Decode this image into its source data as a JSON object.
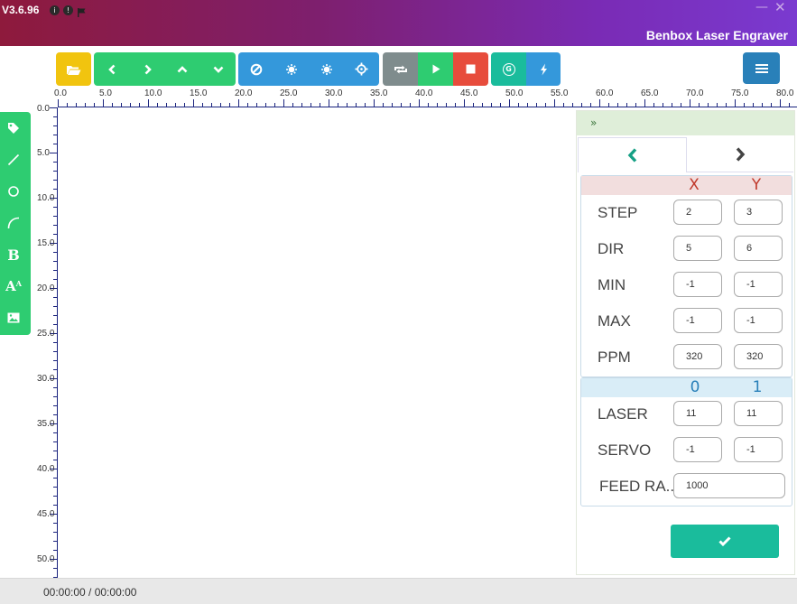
{
  "app": {
    "version": "V3.6.96",
    "name": "Benbox Laser Engraver"
  },
  "window": {
    "minimize_glyph": "—",
    "close_glyph": "✕"
  },
  "colors": {
    "yellow": "#f1c40f",
    "green": "#2ecc71",
    "blue": "#3498db",
    "gray": "#7f8c8d",
    "red": "#e74c3c",
    "teal": "#1abc9c",
    "menu_blue": "#2980b9"
  },
  "toolbar": {
    "open_file": "folder-open-icon",
    "move_left": "chevron-left-icon",
    "move_right": "chevron-right-icon",
    "move_up": "chevron-up-icon",
    "move_down": "chevron-down-icon",
    "disable": "ban-icon",
    "power_low": "sun-low-icon",
    "power_high": "sun-high-icon",
    "crosshair": "crosshair-icon",
    "repeat": "repeat-icon",
    "start": "play-icon",
    "stop": "stop-icon",
    "g_code": "g-code-icon",
    "flash": "bolt-icon",
    "menu": "hamburger-icon",
    "g_label": "G"
  },
  "ruler": {
    "x_labels": [
      "0.0",
      "5.0",
      "10.0",
      "15.0",
      "20.0",
      "25.0",
      "30.0",
      "35.0",
      "40.0",
      "45.0",
      "50.0",
      "55.0",
      "60.0",
      "65.0",
      "70.0",
      "75.0",
      "80.0"
    ],
    "y_labels": [
      "0.0",
      "5.0",
      "10.0",
      "15.0",
      "20.0",
      "25.0",
      "30.0",
      "35.0",
      "40.0",
      "45.0",
      "50.0"
    ]
  },
  "left_tools": [
    "tag-icon",
    "line-icon",
    "circle-icon",
    "arc-icon",
    "bold-text-icon",
    "font-size-icon",
    "image-icon"
  ],
  "left_tools_text": {
    "bold": "B",
    "font": "A"
  },
  "panel": {
    "header_glyph": "»",
    "axis_headers": [
      "X",
      "Y"
    ],
    "rows": [
      {
        "label": "STEP",
        "x": "2",
        "y": "3"
      },
      {
        "label": "DIR",
        "x": "5",
        "y": "6"
      },
      {
        "label": "MIN",
        "x": "-1",
        "y": "-1"
      },
      {
        "label": "MAX",
        "x": "-1",
        "y": "-1"
      },
      {
        "label": "PPM",
        "x": "320",
        "y": "320"
      }
    ],
    "channel_headers": [
      "0",
      "1"
    ],
    "channel_rows": [
      {
        "label": "LASER",
        "c0": "11",
        "c1": "11"
      },
      {
        "label": "SERVO",
        "c0": "-1",
        "c1": "-1"
      }
    ],
    "feed_rate": {
      "label": "FEED RA..",
      "value": "1000"
    },
    "apply": "check-icon"
  },
  "status": {
    "elapsed": "00:00:00 / 00:00:00"
  }
}
